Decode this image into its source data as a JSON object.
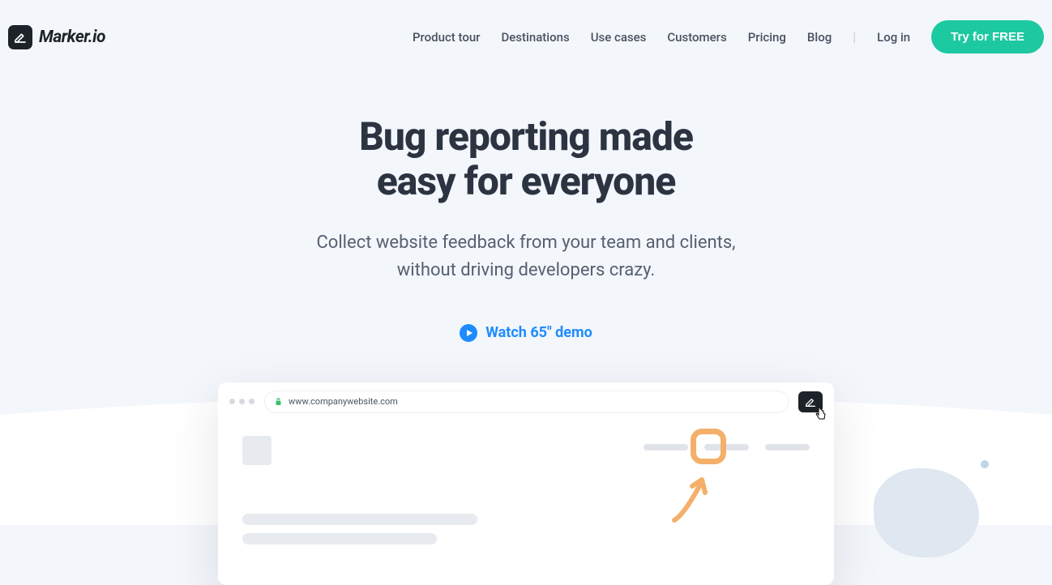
{
  "brand": {
    "name": "Marker.io"
  },
  "nav": {
    "items": [
      "Product tour",
      "Destinations",
      "Use cases",
      "Customers",
      "Pricing",
      "Blog"
    ],
    "login": "Log in",
    "cta": "Try for FREE"
  },
  "hero": {
    "title_line1": "Bug reporting made",
    "title_line2": "easy for everyone",
    "subtitle_line1": "Collect website feedback from your team and clients,",
    "subtitle_line2": "without driving developers crazy.",
    "demo_label": "Watch 65\" demo"
  },
  "mock": {
    "url": "www.companywebsite.com"
  }
}
